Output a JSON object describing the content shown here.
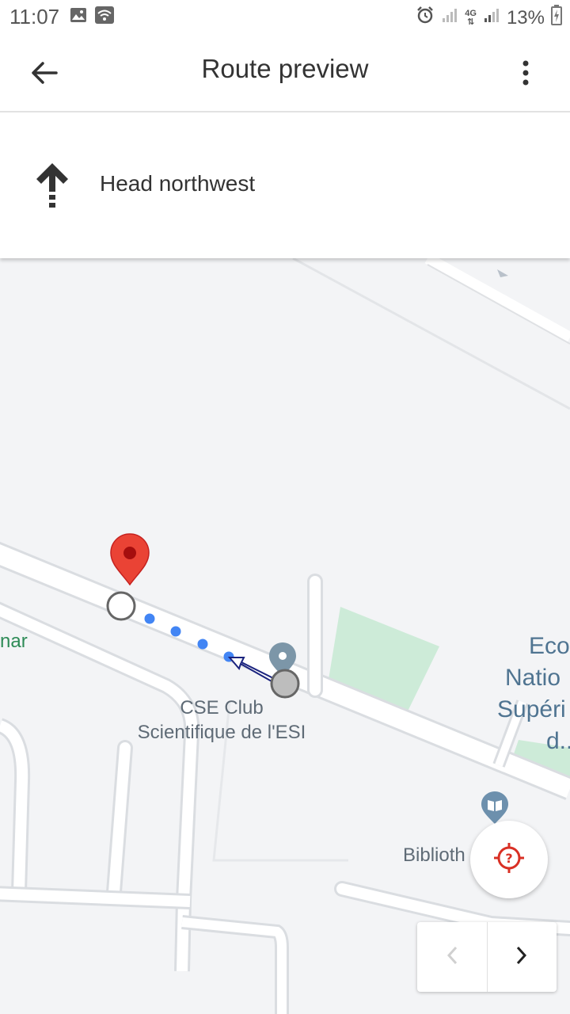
{
  "status_bar": {
    "time": "11:07",
    "network_type": "4G",
    "battery": "13%"
  },
  "app_bar": {
    "title": "Route preview"
  },
  "direction": {
    "instruction": "Head northwest",
    "icon": "arrow-up-icon"
  },
  "map": {
    "labels": {
      "place_left_partial": "nar",
      "poi_name_line1": "CSE Club",
      "poi_name_line2": "Scientifique de l'ESI",
      "school_line1": "Eco",
      "school_line2": "Natio",
      "school_line3": "Supéri",
      "school_line4": "d...",
      "library_partial": "Biblioth"
    }
  },
  "colors": {
    "route_dot": "#4285f4",
    "destination_pin": "#ea4335",
    "park_green": "#cdebd8",
    "recenter_red": "#d93025"
  }
}
